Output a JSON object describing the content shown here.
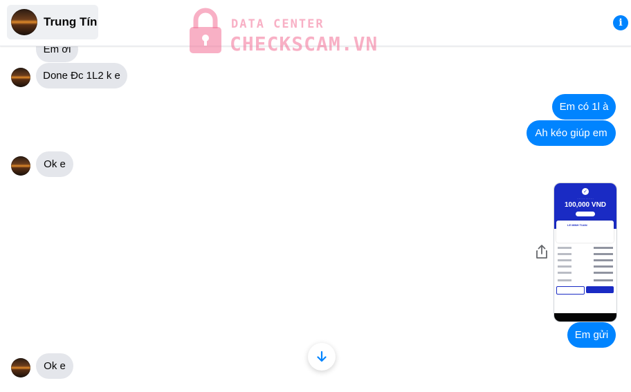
{
  "header": {
    "contact_name": "Trung Tín",
    "info_icon": "info-icon",
    "accent": "#0084ff"
  },
  "watermark": {
    "line1": "DATA CENTER",
    "line2": "CHECKSCAM.VN",
    "color": "#f27096",
    "icon": "padlock-icon"
  },
  "messages": [
    {
      "from": "contact",
      "text": "Em ơi"
    },
    {
      "from": "contact",
      "text": "Done Đc 1L2 k e"
    },
    {
      "from": "me",
      "text": "Em có 1l à"
    },
    {
      "from": "me",
      "text": "Ah kéo giúp em"
    },
    {
      "from": "contact",
      "text": "Ok e"
    },
    {
      "from": "me",
      "type": "image",
      "image": {
        "description": "bank transfer receipt",
        "amount": "100,000 VND",
        "recipient": "LE MINH TUAN"
      }
    },
    {
      "from": "me",
      "text": "Em gửi"
    },
    {
      "from": "contact",
      "text": "Ok e"
    }
  ],
  "controls": {
    "share_icon": "share-icon",
    "scroll_down_icon": "arrow-down-icon"
  },
  "colors": {
    "incoming_bubble": "#e4e6eb",
    "outgoing_bubble": "#0084ff"
  }
}
